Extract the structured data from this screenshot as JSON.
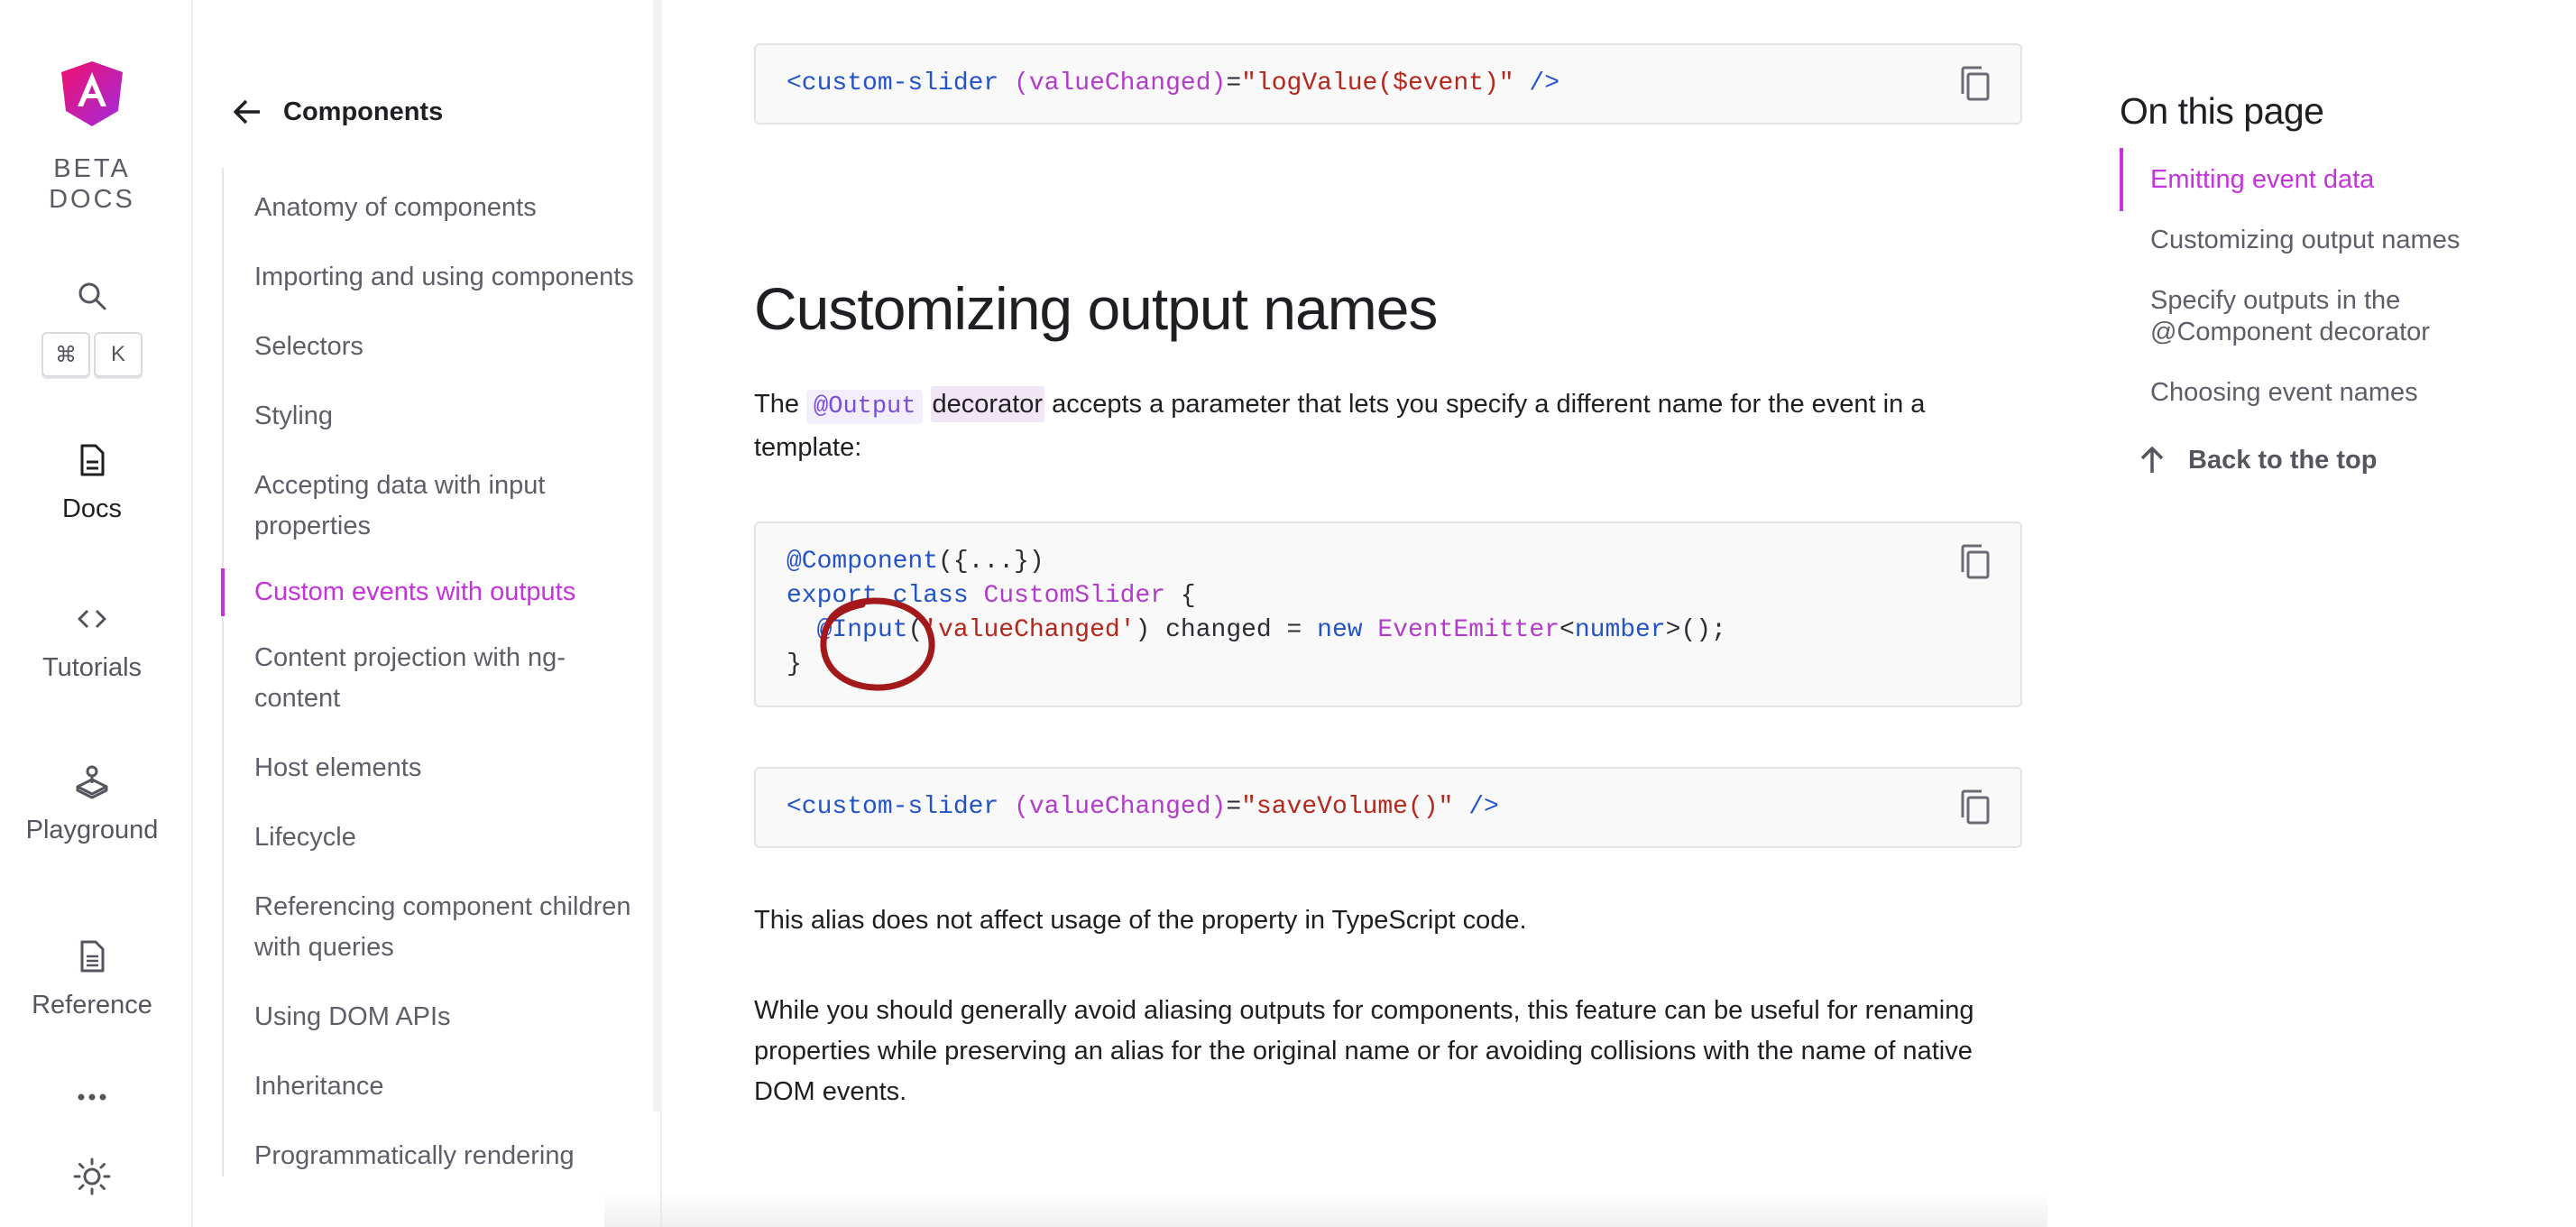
{
  "rail": {
    "logo_text_line1": "BETA",
    "logo_text_line2": "DOCS",
    "shortcut_key1": "⌘",
    "shortcut_key2": "K",
    "items": [
      {
        "label": "Docs",
        "icon": "document-icon",
        "active": true
      },
      {
        "label": "Tutorials",
        "icon": "code-brackets-icon",
        "active": false
      },
      {
        "label": "Playground",
        "icon": "joystick-icon",
        "active": false
      },
      {
        "label": "Reference",
        "icon": "reference-doc-icon",
        "active": false
      }
    ]
  },
  "nav": {
    "back_label": "Components",
    "items": [
      {
        "label": "Anatomy of components",
        "active": false
      },
      {
        "label": "Importing and using components",
        "active": false
      },
      {
        "label": "Selectors",
        "active": false
      },
      {
        "label": "Styling",
        "active": false
      },
      {
        "label": "Accepting data with input properties",
        "active": false
      },
      {
        "label": "Custom events with outputs",
        "active": true
      },
      {
        "label": "Content projection with ng-content",
        "active": false
      },
      {
        "label": "Host elements",
        "active": false
      },
      {
        "label": "Lifecycle",
        "active": false
      },
      {
        "label": "Referencing component children with queries",
        "active": false
      },
      {
        "label": "Using DOM APIs",
        "active": false
      },
      {
        "label": "Inheritance",
        "active": false
      },
      {
        "label": "Programmatically rendering",
        "active": false
      }
    ]
  },
  "main": {
    "code1": {
      "tag_open": "<custom-slider",
      "event": "(valueChanged)",
      "eq": "=",
      "value": "\"logValue($event)\"",
      "tag_close": "/>"
    },
    "heading": "Customizing output names",
    "intro": {
      "pre": "The",
      "code": "@Output",
      "hl": "decorator",
      "post": "accepts a parameter that lets you specify a different name for the event in a template:"
    },
    "code2": {
      "l1_dec": "@Component",
      "l1_rest": "({...})",
      "l2_kw": "export class",
      "l2_cls": "CustomSlider",
      "l2_rest": "{",
      "l3_dec": "@Input",
      "l3_p1": "(",
      "l3_str": "'valueChanged'",
      "l3_p2": ") changed =",
      "l3_kw": "new",
      "l3_cls": "EventEmitter",
      "l3_lt": "<",
      "l3_type": "number",
      "l3_end": ">();",
      "l4": "}"
    },
    "code3": {
      "tag_open": "<custom-slider",
      "event": "(valueChanged)",
      "eq": "=",
      "value": "\"saveVolume()\"",
      "tag_close": "/>"
    },
    "para1": "This alias does not affect usage of the property in TypeScript code.",
    "para2": "While you should generally avoid aliasing outputs for components, this feature can be useful for renaming properties while preserving an alias for the original name or for avoiding collisions with the name of native DOM events."
  },
  "toc": {
    "title": "On this page",
    "items": [
      {
        "label": "Emitting event data",
        "active": true
      },
      {
        "label": "Customizing output names",
        "active": false
      },
      {
        "label": "Specify outputs in the @Component decorator",
        "active": false
      },
      {
        "label": "Choosing event names",
        "active": false
      }
    ],
    "back_to_top": "Back to the top"
  },
  "colors": {
    "accent": "#c632dd",
    "annotation": "#a3191b"
  }
}
